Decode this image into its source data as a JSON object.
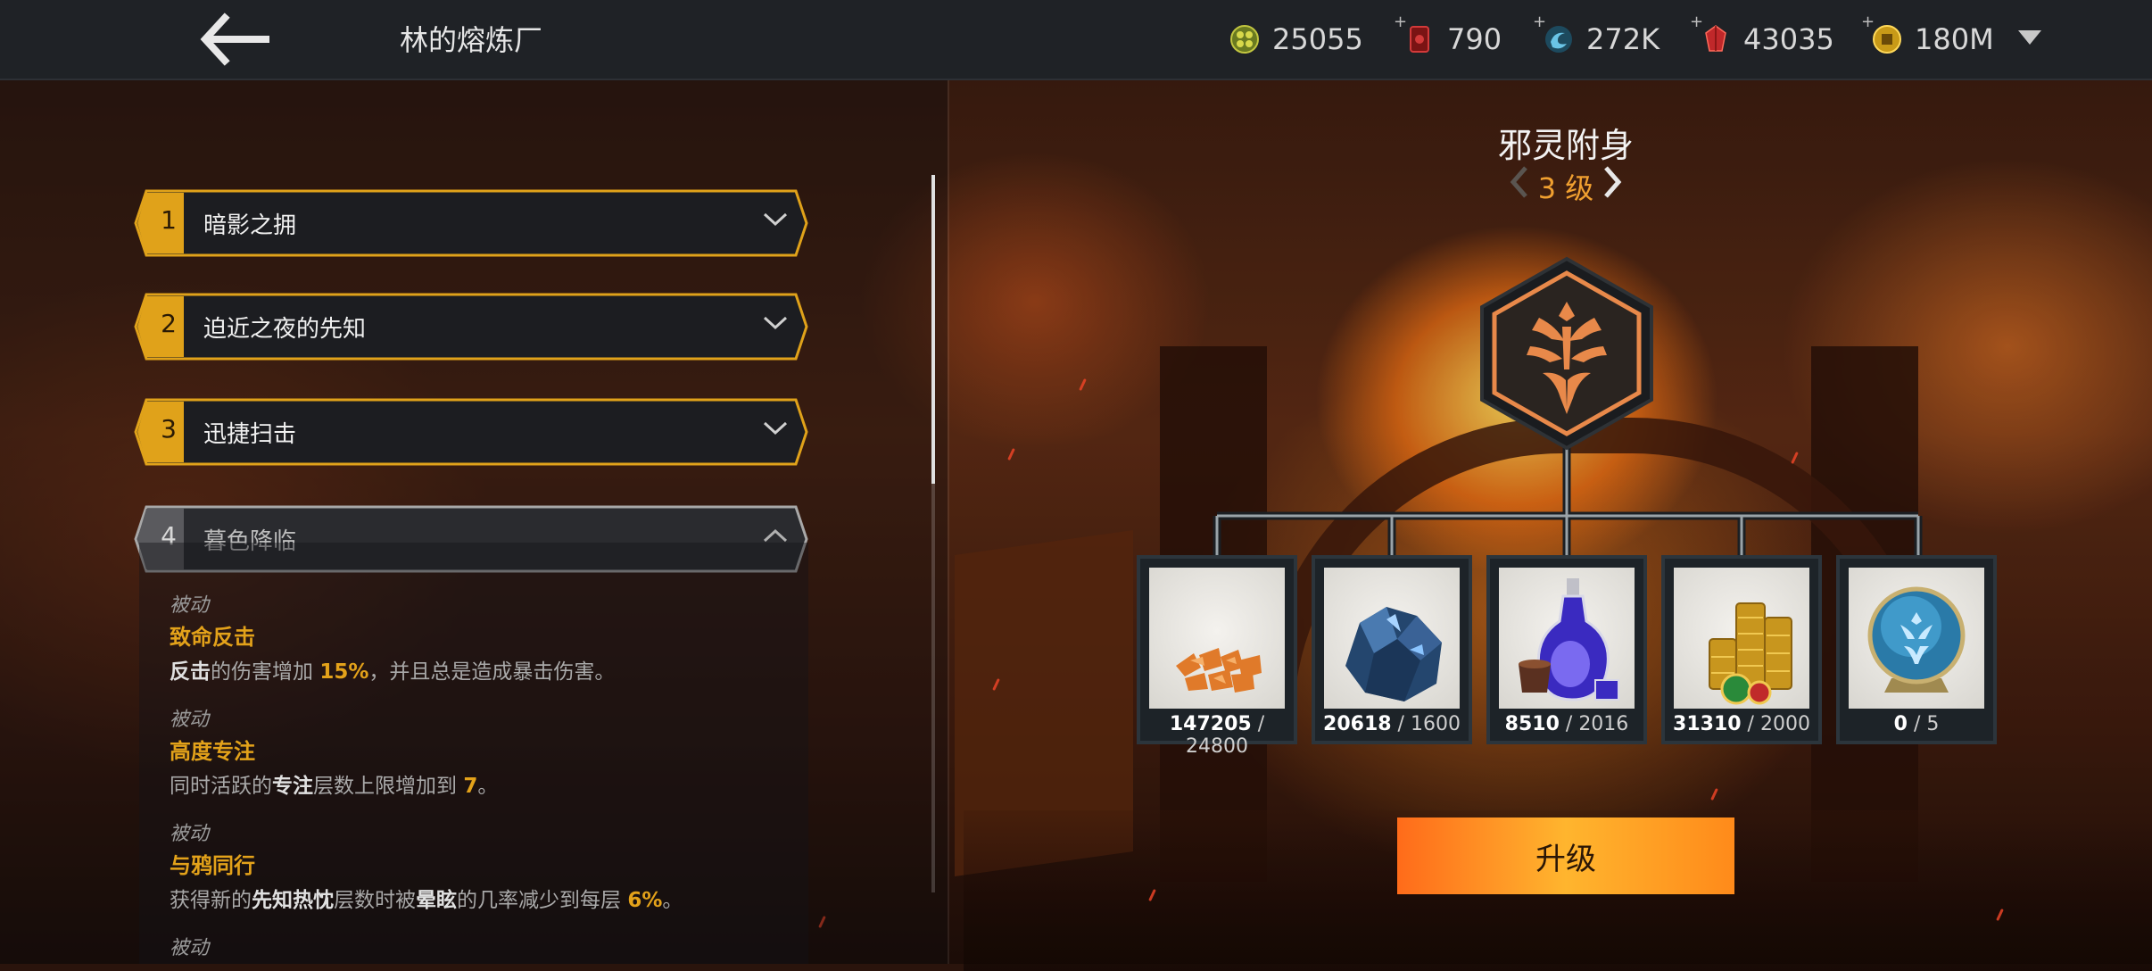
{
  "header": {
    "title": "林的熔炼厂",
    "resources": [
      {
        "icon": "gold-coin-cluster-icon",
        "value": "25055",
        "plus": false
      },
      {
        "icon": "red-card-icon",
        "value": "790",
        "plus": true
      },
      {
        "icon": "blue-swirl-icon",
        "value": "272K",
        "plus": true
      },
      {
        "icon": "red-gem-icon",
        "value": "43035",
        "plus": true
      },
      {
        "icon": "gold-coin-icon",
        "value": "180M",
        "plus": true
      }
    ],
    "plus_sign": "+"
  },
  "talents": [
    {
      "num": "1",
      "label": "暗影之拥",
      "expanded": false
    },
    {
      "num": "2",
      "label": "迫近之夜的先知",
      "expanded": false
    },
    {
      "num": "3",
      "label": "迅捷扫击",
      "expanded": false
    },
    {
      "num": "4",
      "label": "暮色降临",
      "expanded": true
    }
  ],
  "details": [
    {
      "type": "被动",
      "name": "致命反击",
      "desc": [
        {
          "t": "反击",
          "s": "b"
        },
        {
          "t": "的伤害增加 ",
          "s": ""
        },
        {
          "t": "15%",
          "s": "hl"
        },
        {
          "t": "，并且总是造成暴击伤害。",
          "s": ""
        }
      ]
    },
    {
      "type": "被动",
      "name": "高度专注",
      "desc": [
        {
          "t": "同时活跃的",
          "s": ""
        },
        {
          "t": "专注",
          "s": "b"
        },
        {
          "t": "层数上限增加到 ",
          "s": ""
        },
        {
          "t": "7",
          "s": "hl"
        },
        {
          "t": "。",
          "s": ""
        }
      ]
    },
    {
      "type": "被动",
      "name": "与鸦同行",
      "desc": [
        {
          "t": "获得新的",
          "s": ""
        },
        {
          "t": "先知热忱",
          "s": "b"
        },
        {
          "t": "层数时被",
          "s": ""
        },
        {
          "t": "晕眩",
          "s": "b"
        },
        {
          "t": "的几率减少到每层 ",
          "s": ""
        },
        {
          "t": "6%",
          "s": "hl"
        },
        {
          "t": "。",
          "s": ""
        }
      ]
    },
    {
      "type": "被动",
      "name": "",
      "desc": []
    }
  ],
  "skill": {
    "name": "邪灵附身",
    "level": "3 级"
  },
  "materials": [
    {
      "icon": "orange-shards-icon",
      "have": "147205",
      "need": "24800"
    },
    {
      "icon": "blue-crystal-ore-icon",
      "have": "20618",
      "need": "1600"
    },
    {
      "icon": "potion-bottles-icon",
      "have": "8510",
      "need": "2016"
    },
    {
      "icon": "gold-coin-stacks-icon",
      "have": "31310",
      "need": "2000"
    },
    {
      "icon": "blue-emblem-orb-icon",
      "have": "0",
      "need": "5"
    }
  ],
  "count_sep": " / ",
  "upgrade_label": "升级",
  "colors": {
    "accent": "#e3a21a",
    "highlight": "#f0a030",
    "button": "#ff9a22"
  }
}
